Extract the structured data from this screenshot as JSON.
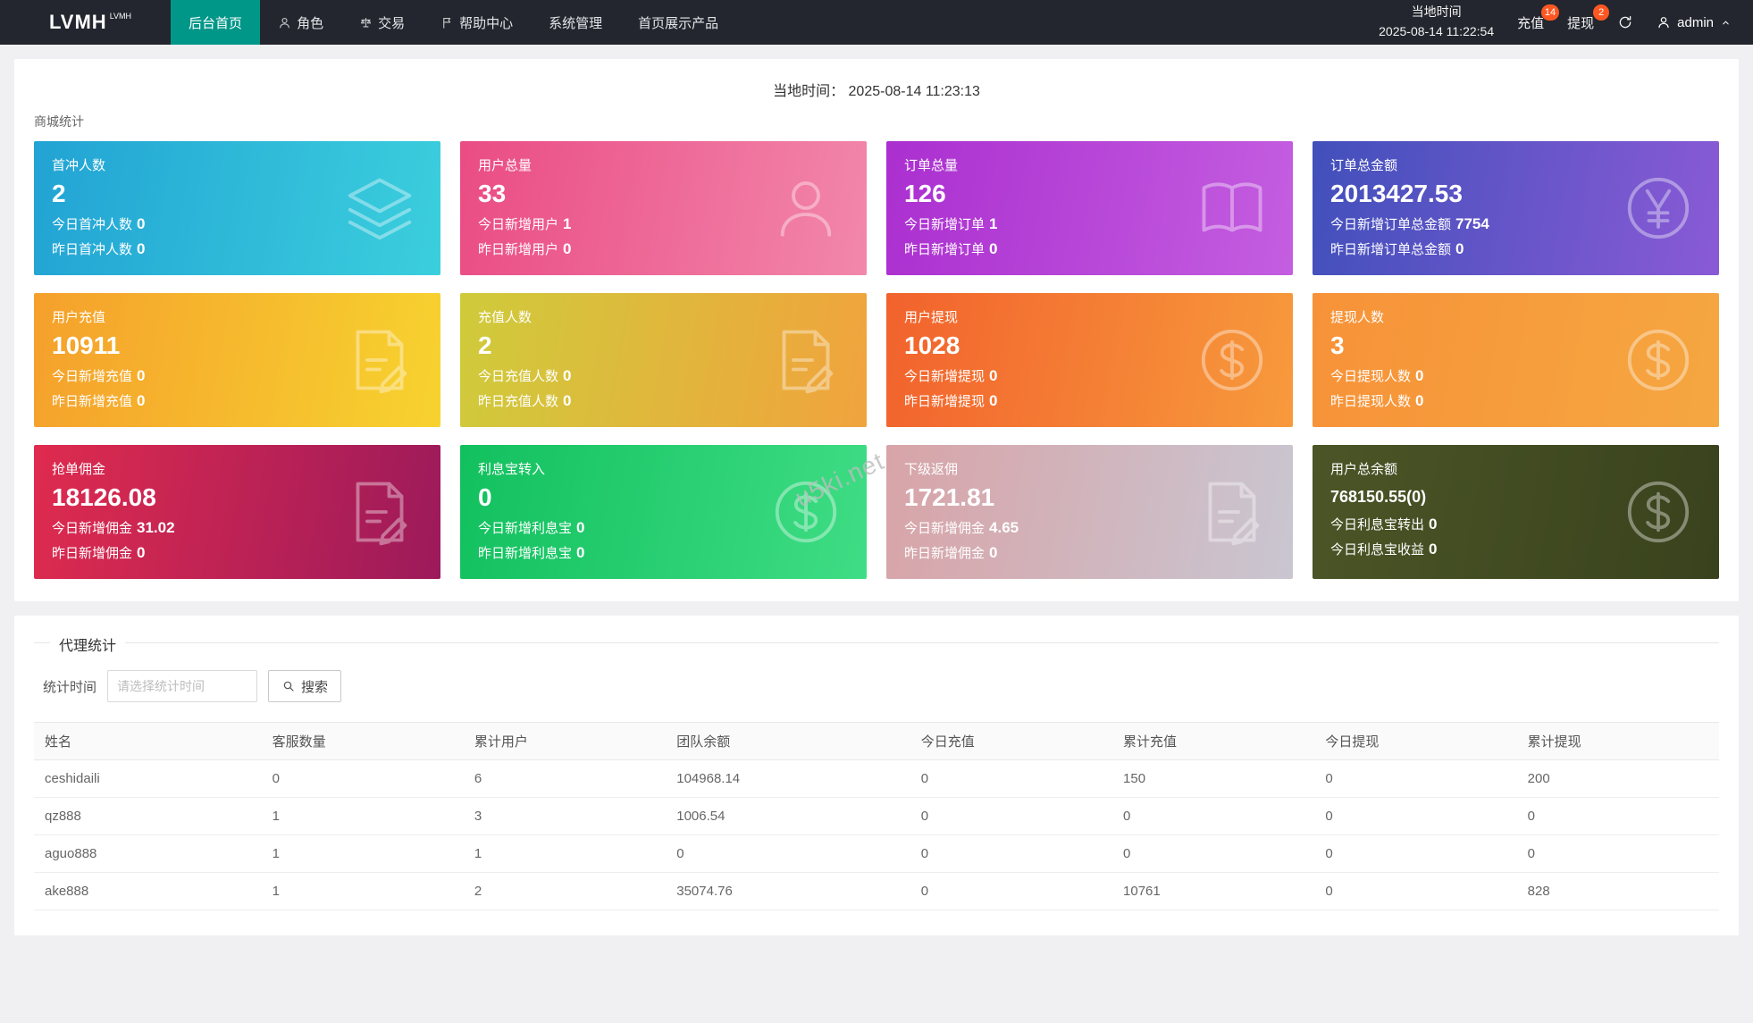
{
  "theme": {
    "navbar_bg": "#23262e",
    "active_tab": "#009688",
    "badge_color": "#ff5722"
  },
  "navbar": {
    "logo": "LVMH",
    "logo_sup": "LVMH",
    "items": [
      {
        "label": "后台首页",
        "active": true
      },
      {
        "label": "角色",
        "icon": "user-icon"
      },
      {
        "label": "交易",
        "icon": "scale-icon"
      },
      {
        "label": "帮助中心",
        "icon": "flag-icon"
      },
      {
        "label": "系统管理"
      },
      {
        "label": "首页展示产品"
      }
    ],
    "local_time_label": "当地时间",
    "local_time": "2025-08-14 11:22:54",
    "recharge_label": "充值",
    "recharge_badge": "14",
    "withdraw_label": "提现",
    "withdraw_badge": "2",
    "refresh_icon": "refresh-icon",
    "user_name": "admin"
  },
  "main": {
    "time_label": "当地时间：",
    "time_value": "2025-08-14 11:23:13",
    "section_title": "商城统计",
    "watermark": "u5ki.net"
  },
  "cards": [
    {
      "title": "首冲人数",
      "value": "2",
      "line1_label": "今日首冲人数",
      "line1_value": "0",
      "line2_label": "昨日首冲人数",
      "line2_value": "0",
      "icon": "layers-icon",
      "colors": [
        "#22a3d4",
        "#3bcfdd"
      ]
    },
    {
      "title": "用户总量",
      "value": "33",
      "line1_label": "今日新增用户",
      "line1_value": "1",
      "line2_label": "昨日新增用户",
      "line2_value": "0",
      "icon": "user-icon",
      "colors": [
        "#ea4c84",
        "#f287ab"
      ]
    },
    {
      "title": "订单总量",
      "value": "126",
      "line1_label": "今日新增订单",
      "line1_value": "1",
      "line2_label": "昨日新增订单",
      "line2_value": "0",
      "icon": "book-icon",
      "colors": [
        "#ab2fd0",
        "#c45ee0"
      ]
    },
    {
      "title": "订单总金额",
      "value": "2013427.53",
      "line1_label": "今日新增订单总金额",
      "line1_value": "7754",
      "line2_label": "昨日新增订单总金额",
      "line2_value": "0",
      "icon": "yen-icon",
      "colors": [
        "#4150bb",
        "#8a5ad6"
      ]
    },
    {
      "title": "用户充值",
      "value": "10911",
      "line1_label": "今日新增充值",
      "line1_value": "0",
      "line2_label": "昨日新增充值",
      "line2_value": "0",
      "icon": "edit-doc-icon",
      "colors": [
        "#f5a02c",
        "#f7d32f"
      ]
    },
    {
      "title": "充值人数",
      "value": "2",
      "line1_label": "今日充值人数",
      "line1_value": "0",
      "line2_label": "昨日充值人数",
      "line2_value": "0",
      "icon": "edit-doc-icon",
      "colors": [
        "#cfcb3b",
        "#f1a33d"
      ]
    },
    {
      "title": "用户提现",
      "value": "1028",
      "line1_label": "今日新增提现",
      "line1_value": "0",
      "line2_label": "昨日新增提现",
      "line2_value": "0",
      "icon": "dollar-icon",
      "colors": [
        "#f2622d",
        "#f79a3c"
      ]
    },
    {
      "title": "提现人数",
      "value": "3",
      "line1_label": "今日提现人数",
      "line1_value": "0",
      "line2_label": "昨日提现人数",
      "line2_value": "0",
      "icon": "dollar-icon",
      "colors": [
        "#f79238",
        "#f5a741"
      ]
    },
    {
      "title": "抢单佣金",
      "value": "18126.08",
      "line1_label": "今日新增佣金",
      "line1_value": "31.02",
      "line2_label": "昨日新增佣金",
      "line2_value": "0",
      "icon": "edit-doc-icon",
      "colors": [
        "#df2b4e",
        "#9c1a5b"
      ]
    },
    {
      "title": "利息宝转入",
      "value": "0",
      "line1_label": "今日新增利息宝",
      "line1_value": "0",
      "line2_label": "昨日新增利息宝",
      "line2_value": "0",
      "icon": "dollar-icon",
      "colors": [
        "#12c05e",
        "#3fdd85"
      ]
    },
    {
      "title": "下级返佣",
      "value": "1721.81",
      "line1_label": "今日新增佣金",
      "line1_value": "4.65",
      "line2_label": "昨日新增佣金",
      "line2_value": "0",
      "icon": "edit-doc-icon",
      "colors": [
        "#d8a4a8",
        "#c9c6d1"
      ]
    },
    {
      "title": "用户总余额",
      "value": "768150.55(0)",
      "line1_label": "今日利息宝转出",
      "line1_value": "0",
      "line2_label": "今日利息宝收益",
      "line2_value": "0",
      "icon": "dollar-icon",
      "colors": [
        "#4b5526",
        "#39421d"
      ]
    }
  ],
  "agent": {
    "legend": "代理统计",
    "filter_label": "统计时间",
    "filter_placeholder": "请选择统计时间",
    "search_label": "搜索",
    "table": {
      "headers": [
        "姓名",
        "客服数量",
        "累计用户",
        "团队余额",
        "今日充值",
        "累计充值",
        "今日提现",
        "累计提现"
      ],
      "rows": [
        [
          "ceshidaili",
          "0",
          "6",
          "104968.14",
          "0",
          "150",
          "0",
          "200"
        ],
        [
          "qz888",
          "1",
          "3",
          "1006.54",
          "0",
          "0",
          "0",
          "0"
        ],
        [
          "aguo888",
          "1",
          "1",
          "0",
          "0",
          "0",
          "0",
          "0"
        ],
        [
          "ake888",
          "1",
          "2",
          "35074.76",
          "0",
          "10761",
          "0",
          "828"
        ]
      ]
    }
  }
}
